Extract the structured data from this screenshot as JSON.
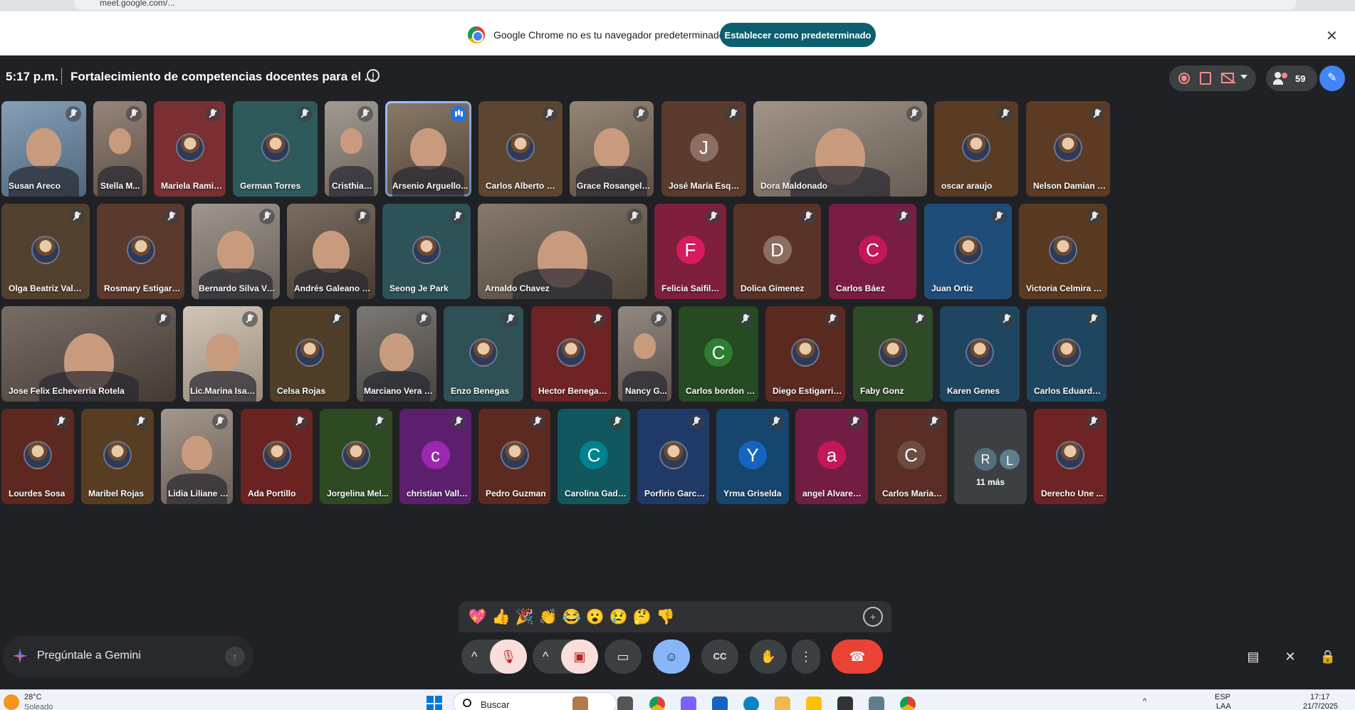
{
  "browser": {
    "url": "meet.google.com/..."
  },
  "infobar": {
    "message": "Google Chrome no es tu navegador predeterminado",
    "button": "Establecer como predeterminado",
    "close": "✕"
  },
  "meeting": {
    "time": "5:17 p.m.",
    "title": "Fortalecimiento de competencias docentes para el ...",
    "people_count": "59"
  },
  "tiles": [
    {
      "name": "Susan Areco",
      "type": "video",
      "bg": "#6b8aa6",
      "mic": "on"
    },
    {
      "name": "Stella M...",
      "type": "video",
      "bg": "#7f6a5c",
      "mic": "muted"
    },
    {
      "name": "Mariela Ramirez",
      "type": "avatar",
      "bg": "#7a2f32",
      "mic": "muted"
    },
    {
      "name": "German Torres",
      "type": "avatar",
      "bg": "#2f5a5c",
      "mic": "muted"
    },
    {
      "name": "Cristhian...",
      "type": "video",
      "bg": "#8d857a",
      "mic": "muted"
    },
    {
      "name": "Arsenio Arguello...",
      "type": "video",
      "bg": "#6f5c48",
      "mic": "speaking"
    },
    {
      "name": "Carlos Alberto Par...",
      "type": "avatar",
      "bg": "#5c4632",
      "mic": "muted"
    },
    {
      "name": "Grace Rosangela ...",
      "type": "video",
      "bg": "#7d6b59",
      "mic": "muted"
    },
    {
      "name": "José María Esquivel",
      "type": "letter",
      "letter": "J",
      "bg": "#5a3b2e",
      "circle": "#8d6e63",
      "mic": "muted"
    },
    {
      "name": "Dora Maldonado",
      "type": "video",
      "bg": "#8c7d70",
      "mic": "muted"
    },
    {
      "name": "oscar araujo",
      "type": "avatar",
      "bg": "#5a3b24",
      "mic": "muted"
    },
    {
      "name": "Nelson Damian C...",
      "type": "avatar",
      "bg": "#5c3a23",
      "mic": "muted"
    },
    {
      "name": "Olga Beatriz Valdez",
      "type": "avatar",
      "bg": "#52412e",
      "mic": "muted"
    },
    {
      "name": "Rosmary Estigarribia",
      "type": "avatar",
      "bg": "#5a3a2c",
      "mic": "muted"
    },
    {
      "name": "Bernardo Silva Vera",
      "type": "video",
      "bg": "#8a7f75",
      "mic": "muted"
    },
    {
      "name": "Andrés Galeano G...",
      "type": "video",
      "bg": "#5e4d3f",
      "mic": "muted"
    },
    {
      "name": "Seong Je Park",
      "type": "avatar",
      "bg": "#2d5257",
      "mic": "muted"
    },
    {
      "name": "Arnaldo Chavez",
      "type": "video",
      "bg": "#6b5c4d",
      "mic": "muted"
    },
    {
      "name": "Felicia Saifildin",
      "type": "letter",
      "letter": "F",
      "bg": "#7e1f3c",
      "circle": "#d81b60",
      "mic": "muted"
    },
    {
      "name": "Dolica Gimenez",
      "type": "letter",
      "letter": "D",
      "bg": "#5a3328",
      "circle": "#8d6e63",
      "mic": "muted"
    },
    {
      "name": "Carlos Báez",
      "type": "letter",
      "letter": "C",
      "bg": "#7a1d45",
      "circle": "#c2185b",
      "mic": "muted"
    },
    {
      "name": "Juan Ortiz",
      "type": "avatar",
      "bg": "#1f4d7a",
      "mic": "muted"
    },
    {
      "name": "Victoria Celmira Gi...",
      "type": "avatar",
      "bg": "#5a3a20",
      "mic": "muted"
    },
    {
      "name": "Jose Felix Echeverria Rotela",
      "type": "video",
      "bg": "#5b4d45",
      "mic": "muted"
    },
    {
      "name": "Lic.Marina Isabel...",
      "type": "video",
      "bg": "#c9b8a6",
      "mic": "muted"
    },
    {
      "name": "Celsa Rojas",
      "type": "avatar",
      "bg": "#4f3e28",
      "mic": "muted"
    },
    {
      "name": "Marciano Vera Vi...",
      "type": "video",
      "bg": "#5f5a55",
      "mic": "muted"
    },
    {
      "name": "Enzo Benegas",
      "type": "avatar",
      "bg": "#2f5055",
      "mic": "muted"
    },
    {
      "name": "Hector Benegas ...",
      "type": "avatar",
      "bg": "#6e2424",
      "mic": "muted"
    },
    {
      "name": "Nancy G...",
      "type": "video",
      "bg": "#7a6e66",
      "mic": "muted"
    },
    {
      "name": "Carlos bordon p...",
      "type": "letter",
      "letter": "C",
      "bg": "#264a21",
      "circle": "#2e7d32",
      "mic": "muted"
    },
    {
      "name": "Diego Estigarribia",
      "type": "avatar",
      "bg": "#5a2a20",
      "mic": "muted"
    },
    {
      "name": "Faby Gonz",
      "type": "avatar",
      "bg": "#2f4a26",
      "mic": "muted"
    },
    {
      "name": "Karen Genes",
      "type": "avatar",
      "bg": "#1f4660",
      "mic": "muted"
    },
    {
      "name": "Carlos Eduardo ...",
      "type": "avatar",
      "bg": "#1f4660",
      "mic": "muted"
    },
    {
      "name": "Lourdes Sosa",
      "type": "avatar",
      "bg": "#5c2820",
      "mic": "muted"
    },
    {
      "name": "Maribel Rojas",
      "type": "avatar",
      "bg": "#573d22",
      "mic": "muted"
    },
    {
      "name": "Lidia Liliane C...",
      "type": "video",
      "bg": "#8f7f72",
      "mic": "muted"
    },
    {
      "name": "Ada Portillo",
      "type": "avatar",
      "bg": "#6b2322",
      "mic": "muted"
    },
    {
      "name": "Jorgelina Mel...",
      "type": "avatar",
      "bg": "#2d4a22",
      "mic": "muted"
    },
    {
      "name": "christian Vallej...",
      "type": "letter",
      "letter": "c",
      "bg": "#5b1f6e",
      "circle": "#9c27b0",
      "mic": "muted"
    },
    {
      "name": "Pedro Guzman",
      "type": "avatar",
      "bg": "#5c2a20",
      "mic": "muted"
    },
    {
      "name": "Carolina Gadea",
      "type": "letter",
      "letter": "C",
      "bg": "#12575e",
      "circle": "#00838f",
      "mic": "muted"
    },
    {
      "name": "Porfirio Garce...",
      "type": "avatar",
      "bg": "#1f3a66",
      "mic": "muted"
    },
    {
      "name": "Yrma Griselda",
      "type": "letter",
      "letter": "Y",
      "bg": "#16456e",
      "circle": "#1565c0",
      "mic": "muted"
    },
    {
      "name": "angel Alvarenga",
      "type": "letter",
      "letter": "a",
      "bg": "#731d44",
      "circle": "#c2185b",
      "mic": "muted"
    },
    {
      "name": "Carlos Maria V...",
      "type": "letter",
      "letter": "C",
      "bg": "#5a2e26",
      "circle": "#6d4c41",
      "mic": "muted"
    },
    {
      "name": "11 más",
      "type": "more",
      "bg": "#3c4043",
      "r": "R",
      "l": "L"
    },
    {
      "name": "Derecho Une ...",
      "type": "avatar",
      "bg": "#6e2424",
      "mic": "muted"
    }
  ],
  "reactions": [
    "💖",
    "👍",
    "🎉",
    "👏",
    "😂",
    "😮",
    "😢",
    "🤔",
    "👎"
  ],
  "gemini": {
    "placeholder": "Pregúntale a Gemini"
  },
  "controls": {
    "mic_menu": "^",
    "cam_menu": "^",
    "present": "▭",
    "emoji": "☺",
    "captions": "CC",
    "hand": "✋",
    "more": "⋮",
    "hangup": "☎"
  },
  "side_controls": {
    "chat": "▤",
    "activities": "✕",
    "host": "🔒"
  },
  "taskbar": {
    "temp": "28°C",
    "weather": "Soleado",
    "search": "Buscar",
    "lang": "ESP",
    "lang2": "LAA",
    "time": "17:17",
    "date": "21/7/2025"
  }
}
